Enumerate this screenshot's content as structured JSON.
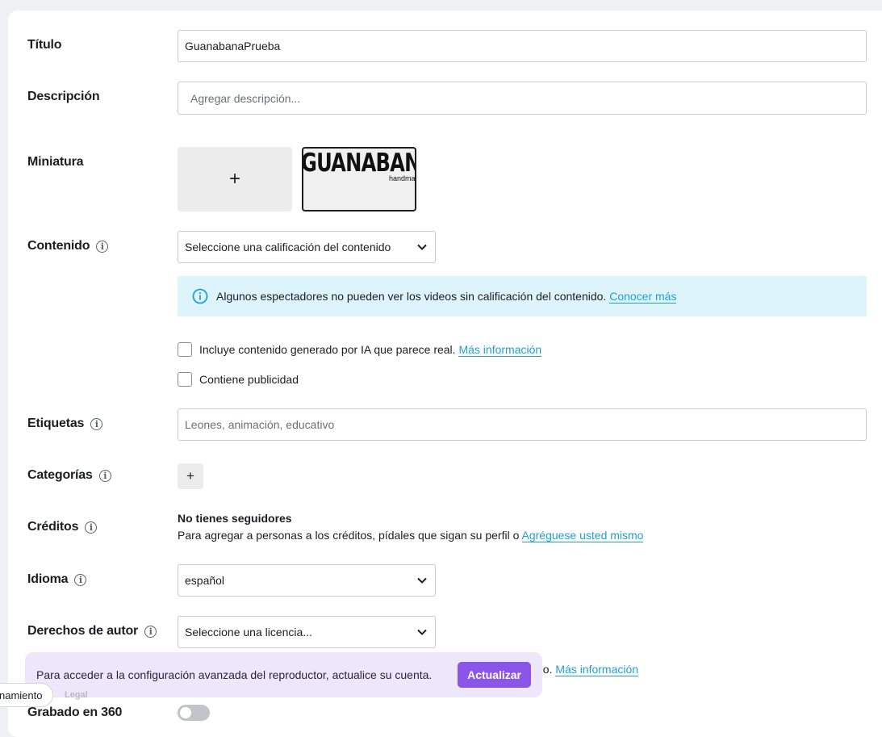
{
  "form": {
    "title_label": "Título",
    "title_value": "GuanabanaPrueba",
    "description_label": "Descripción",
    "description_placeholder": "Agregar descripción...",
    "thumbnail_label": "Miniatura",
    "thumbnail_add_glyph": "+",
    "thumbnail_image_text": "GUANABANA",
    "thumbnail_image_subtext": "handmade",
    "content_label": "Contenido",
    "content_select": "Seleccione una calificación del contenido",
    "content_notice": "Algunos espectadores no pueden ver los videos sin calificación del contenido.",
    "content_notice_link": "Conocer más",
    "ai_checkbox_label": "Incluye contenido generado por IA que parece real.",
    "ai_checkbox_link": "Más información",
    "ai_checked": false,
    "ads_checkbox_label": "Contiene publicidad",
    "ads_checked": false,
    "tags_label": "Etiquetas",
    "tags_placeholder": "Leones, animación, educativo",
    "categories_label": "Categorías",
    "categories_add_glyph": "+",
    "credits_label": "Créditos",
    "credits_title": "No tienes seguidores",
    "credits_text": "Para agregar a personas a los créditos, pídales que sigan su perfil o",
    "credits_link": "Agréguese usted mismo",
    "language_label": "Idioma",
    "language_value": "español",
    "copyright_label": "Derechos de autor",
    "copyright_select": "Seleccione una licencia...",
    "hidden_text_fragment": "eo.",
    "hidden_link": "Más información",
    "recorded_360_label": "Grabado en 360",
    "recorded_360_on": false
  },
  "banner": {
    "text": "Para acceder a la configuración avanzada del reproductor, actualice su cuenta.",
    "button": "Actualizar"
  },
  "footer": {
    "pill_text": "namiento",
    "legal_text": "Legal"
  },
  "icons": {
    "info": "info-icon",
    "chevron": "chevron-down-icon",
    "plus": "plus-icon"
  },
  "colors": {
    "accent_purple": "#8a55e8",
    "link_blue": "#1f9fd6",
    "notice_bg": "#def4fb",
    "banner_bg": "#ece7fb"
  }
}
